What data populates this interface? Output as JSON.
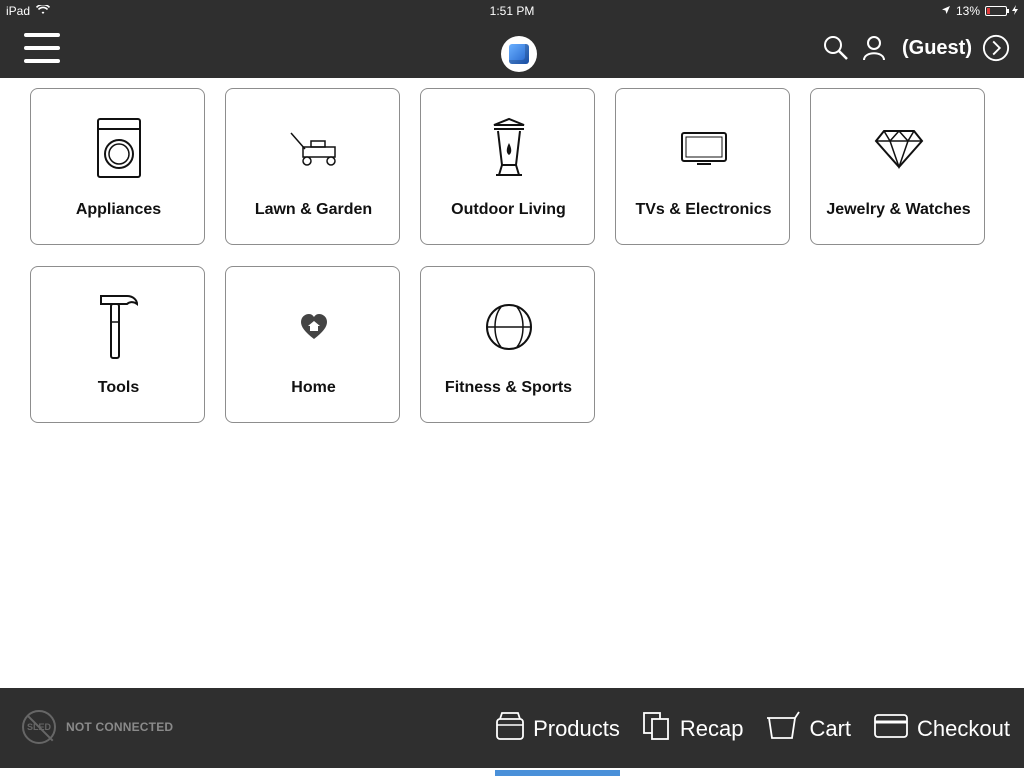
{
  "status": {
    "device": "iPad",
    "time": "1:51 PM",
    "battery": "13%"
  },
  "header": {
    "guest_label": "(Guest)",
    "icons": [
      "menu-icon",
      "app-logo-cube-icon",
      "search-icon",
      "user-icon",
      "chevron-right-circle-icon"
    ]
  },
  "categories": [
    {
      "label": "Appliances",
      "icon": "washing-machine-icon"
    },
    {
      "label": "Lawn & Garden",
      "icon": "lawn-mower-icon"
    },
    {
      "label": "Outdoor Living",
      "icon": "lantern-icon"
    },
    {
      "label": "TVs & Electronics",
      "icon": "tv-icon"
    },
    {
      "label": "Jewelry & Watches",
      "icon": "diamond-icon"
    },
    {
      "label": "Tools",
      "icon": "hammer-icon"
    },
    {
      "label": "Home",
      "icon": "home-heart-icon"
    },
    {
      "label": "Fitness & Sports",
      "icon": "ball-icon"
    }
  ],
  "footer": {
    "connection_icon_text": "SLED",
    "connection_status": "NOT CONNECTED",
    "nav": [
      {
        "label": "Products",
        "icon": "products-box-icon",
        "active": true
      },
      {
        "label": "Recap",
        "icon": "recap-pages-icon",
        "active": false
      },
      {
        "label": "Cart",
        "icon": "cart-icon",
        "active": false
      },
      {
        "label": "Checkout",
        "icon": "credit-card-icon",
        "active": false
      }
    ]
  },
  "colors": {
    "bar": "#2f2f2f",
    "active_tab": "#4a90d9",
    "tile_border": "#8d8d8d"
  }
}
